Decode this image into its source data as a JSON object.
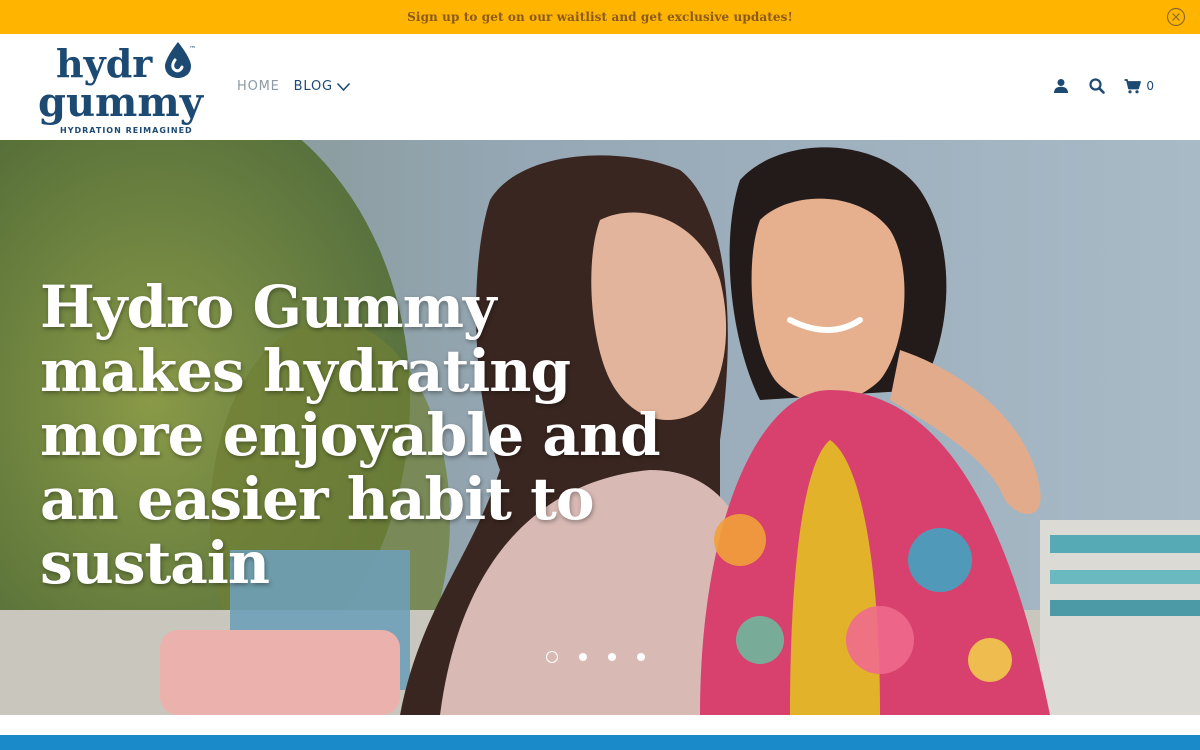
{
  "announcement": {
    "text": "Sign up to get on our waitlist and get exclusive updates!",
    "close_icon": "close-circle-icon",
    "color": "#ffb400"
  },
  "header": {
    "logo": {
      "line1": "hydr",
      "line2": "gummy",
      "trademark": "™",
      "tagline": "HYDRATION REIMAGINED",
      "color": "#1c4a72"
    },
    "nav": {
      "home": "HOME",
      "blog": "BLOG"
    },
    "icons": {
      "account": "user-icon",
      "search": "search-icon",
      "cart": "cart-icon"
    },
    "cart_count": "0"
  },
  "hero": {
    "heading": "Hydro Gummy makes hydrating more enjoyable and an easier habit to sustain",
    "slides": 4,
    "active_slide": 1
  },
  "colors": {
    "brand_blue": "#1c4a72",
    "accent_blue": "#1a8ac9",
    "banner_yellow": "#ffb400"
  }
}
